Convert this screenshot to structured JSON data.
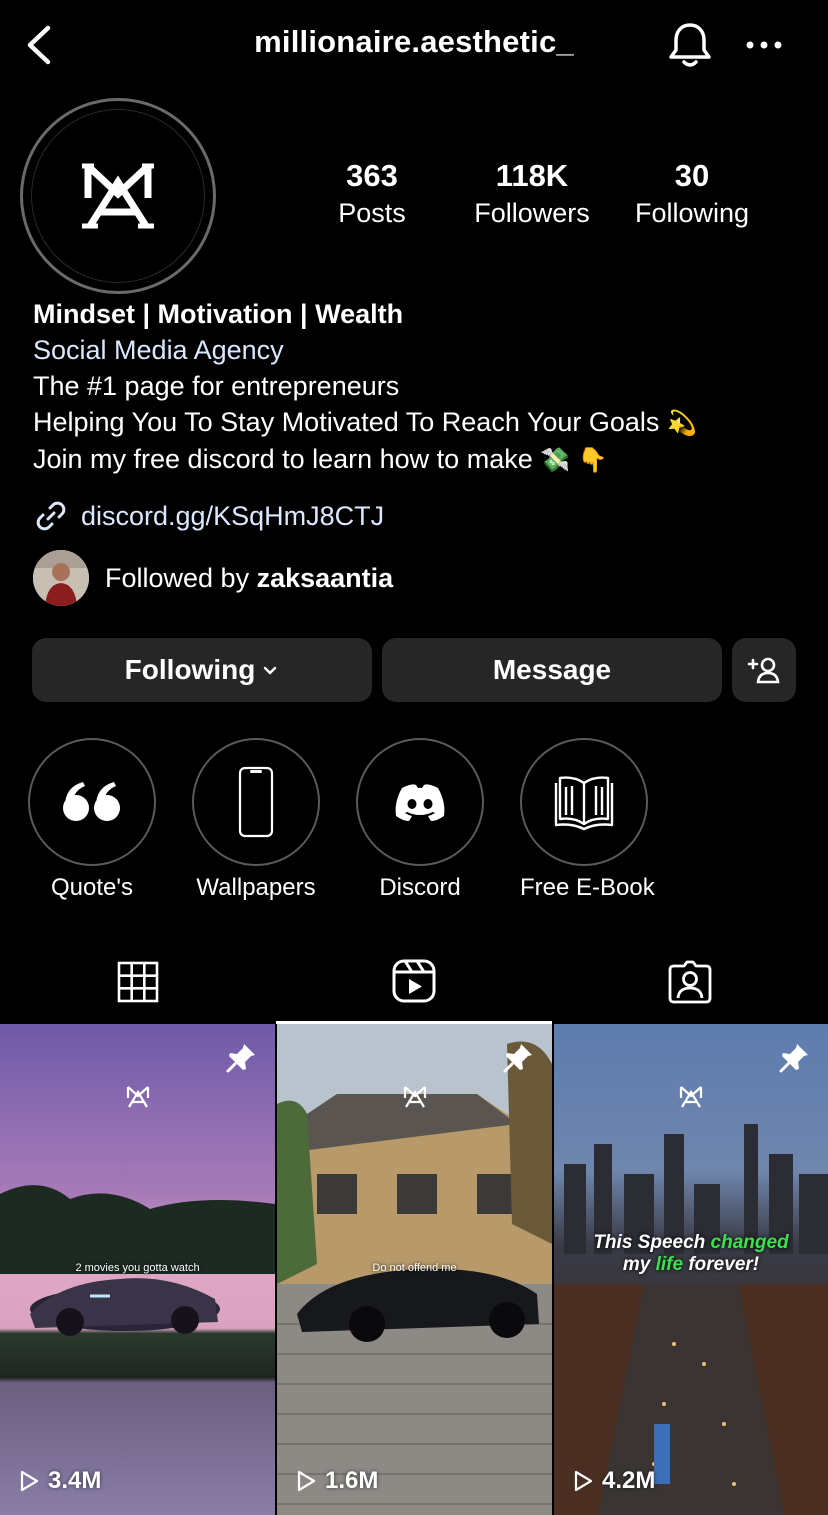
{
  "header": {
    "username": "millionaire.aesthetic_"
  },
  "stats": {
    "posts": {
      "value": "363",
      "label": "Posts"
    },
    "followers": {
      "value": "118K",
      "label": "Followers"
    },
    "following": {
      "value": "30",
      "label": "Following"
    }
  },
  "bio": {
    "name": "Mindset | Motivation | Wealth",
    "category": "Social Media Agency",
    "line1": "The #1 page for entrepreneurs",
    "line2": "Helping You To Stay Motivated To Reach Your Goals",
    "line2_emoji": "💫",
    "line3": "Join my free discord to learn how to make",
    "line3_emoji": "💸 👇",
    "link": "discord.gg/KSqHmJ8CTJ"
  },
  "followed_by": {
    "prefix": "Followed by",
    "user": "zaksaantia"
  },
  "actions": {
    "following_label": "Following",
    "message_label": "Message"
  },
  "highlights": [
    {
      "label": "Quote's",
      "icon": "quote-icon"
    },
    {
      "label": "Wallpapers",
      "icon": "phone-icon"
    },
    {
      "label": "Discord",
      "icon": "discord-icon"
    },
    {
      "label": "Free E-Book",
      "icon": "book-icon"
    }
  ],
  "tabs": [
    {
      "name": "grid",
      "icon": "grid-icon",
      "active": false
    },
    {
      "name": "reels",
      "icon": "reels-icon",
      "active": true
    },
    {
      "name": "tagged",
      "icon": "tagged-icon",
      "active": false
    }
  ],
  "reels": [
    {
      "caption": "2 movies you gotta watch",
      "views": "3.4M",
      "pinned": true
    },
    {
      "caption": "Do not offend me",
      "views": "1.6M",
      "pinned": true
    },
    {
      "caption_part1": "This Speech",
      "caption_part2": "changed",
      "caption_part3": "my",
      "caption_part4": "life",
      "caption_part5": "forever!",
      "views": "4.2M",
      "pinned": true
    }
  ]
}
